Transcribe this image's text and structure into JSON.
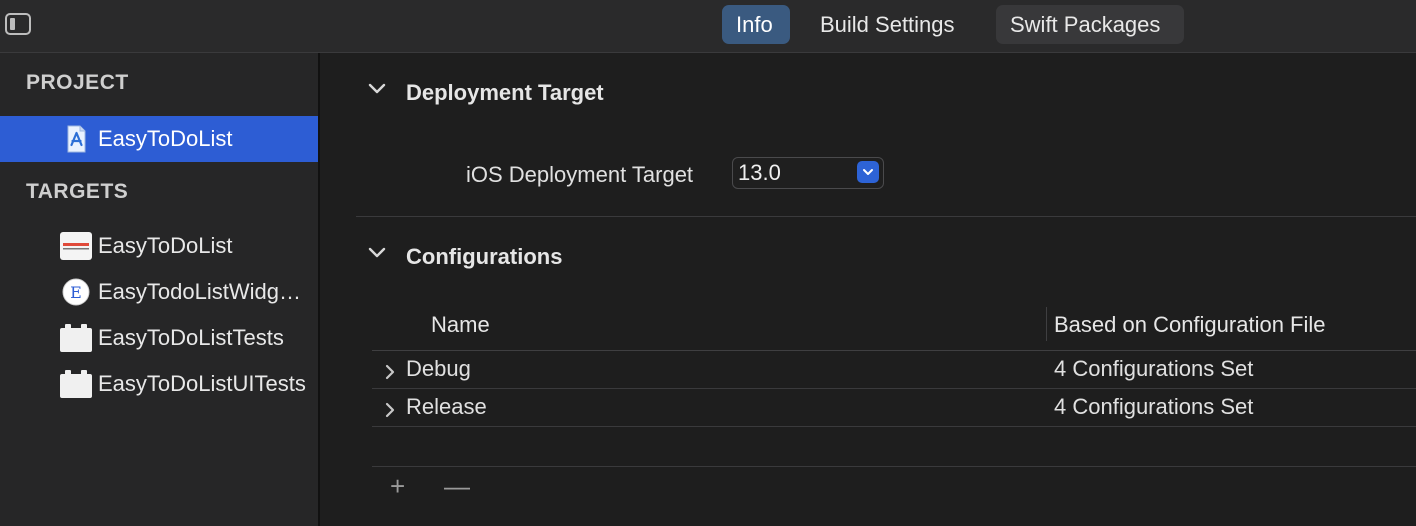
{
  "tabs": [
    {
      "label": "Info",
      "selected": true
    },
    {
      "label": "Build Settings",
      "selected": false
    },
    {
      "label": "Swift Packages",
      "selected": false
    }
  ],
  "sidebar": {
    "project_header": "PROJECT",
    "project_items": [
      {
        "label": "EasyToDoList",
        "icon": "project-file-icon",
        "selected": true
      }
    ],
    "targets_header": "TARGETS",
    "target_items": [
      {
        "label": "EasyToDoList",
        "icon": "app-target-icon"
      },
      {
        "label": "EasyTodoListWidgetExtension",
        "icon": "widget-extension-icon"
      },
      {
        "label": "EasyToDoListTests",
        "icon": "test-bundle-icon"
      },
      {
        "label": "EasyToDoListUITests",
        "icon": "uitest-bundle-icon"
      }
    ]
  },
  "deployment": {
    "title": "Deployment Target",
    "field_label": "iOS Deployment Target",
    "value": "13.0"
  },
  "configurations": {
    "title": "Configurations",
    "columns": [
      "Name",
      "Based on Configuration File"
    ],
    "rows": [
      {
        "name": "Debug",
        "based_on": "4 Configurations Set"
      },
      {
        "name": "Release",
        "based_on": "4 Configurations Set"
      }
    ],
    "add_label": "+",
    "remove_label": "—"
  },
  "colors": {
    "selection": "#2d5dd4",
    "tab_selected": "#3a5a80",
    "background": "#1e1e1e"
  }
}
